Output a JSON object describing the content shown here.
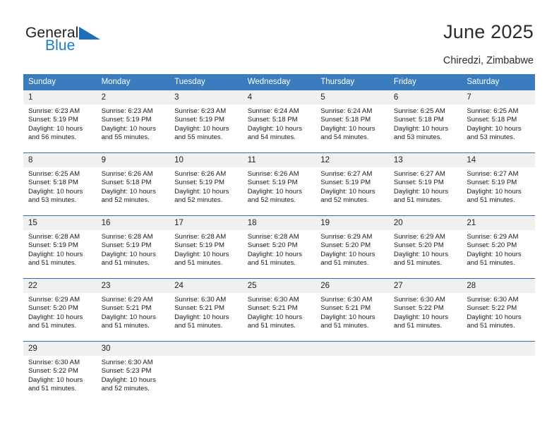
{
  "brand": {
    "name_part1": "General",
    "name_part2": "Blue",
    "triangle_icon": "triangle-icon",
    "color_primary": "#231f20",
    "color_accent": "#1f7ac4"
  },
  "header": {
    "title": "June 2025",
    "subtitle": "Chiredzi, Zimbabwe"
  },
  "calendar": {
    "header_bg": "#3a7cbe",
    "grid_line": "#2f6eaf",
    "daynum_bg": "#f0f0f0",
    "weekdays": [
      "Sunday",
      "Monday",
      "Tuesday",
      "Wednesday",
      "Thursday",
      "Friday",
      "Saturday"
    ],
    "weeks": [
      [
        {
          "day": "1",
          "info": "Sunrise: 6:23 AM\nSunset: 5:19 PM\nDaylight: 10 hours\nand 56 minutes."
        },
        {
          "day": "2",
          "info": "Sunrise: 6:23 AM\nSunset: 5:19 PM\nDaylight: 10 hours\nand 55 minutes."
        },
        {
          "day": "3",
          "info": "Sunrise: 6:23 AM\nSunset: 5:19 PM\nDaylight: 10 hours\nand 55 minutes."
        },
        {
          "day": "4",
          "info": "Sunrise: 6:24 AM\nSunset: 5:18 PM\nDaylight: 10 hours\nand 54 minutes."
        },
        {
          "day": "5",
          "info": "Sunrise: 6:24 AM\nSunset: 5:18 PM\nDaylight: 10 hours\nand 54 minutes."
        },
        {
          "day": "6",
          "info": "Sunrise: 6:25 AM\nSunset: 5:18 PM\nDaylight: 10 hours\nand 53 minutes."
        },
        {
          "day": "7",
          "info": "Sunrise: 6:25 AM\nSunset: 5:18 PM\nDaylight: 10 hours\nand 53 minutes."
        }
      ],
      [
        {
          "day": "8",
          "info": "Sunrise: 6:25 AM\nSunset: 5:18 PM\nDaylight: 10 hours\nand 53 minutes."
        },
        {
          "day": "9",
          "info": "Sunrise: 6:26 AM\nSunset: 5:18 PM\nDaylight: 10 hours\nand 52 minutes."
        },
        {
          "day": "10",
          "info": "Sunrise: 6:26 AM\nSunset: 5:19 PM\nDaylight: 10 hours\nand 52 minutes."
        },
        {
          "day": "11",
          "info": "Sunrise: 6:26 AM\nSunset: 5:19 PM\nDaylight: 10 hours\nand 52 minutes."
        },
        {
          "day": "12",
          "info": "Sunrise: 6:27 AM\nSunset: 5:19 PM\nDaylight: 10 hours\nand 52 minutes."
        },
        {
          "day": "13",
          "info": "Sunrise: 6:27 AM\nSunset: 5:19 PM\nDaylight: 10 hours\nand 51 minutes."
        },
        {
          "day": "14",
          "info": "Sunrise: 6:27 AM\nSunset: 5:19 PM\nDaylight: 10 hours\nand 51 minutes."
        }
      ],
      [
        {
          "day": "15",
          "info": "Sunrise: 6:28 AM\nSunset: 5:19 PM\nDaylight: 10 hours\nand 51 minutes."
        },
        {
          "day": "16",
          "info": "Sunrise: 6:28 AM\nSunset: 5:19 PM\nDaylight: 10 hours\nand 51 minutes."
        },
        {
          "day": "17",
          "info": "Sunrise: 6:28 AM\nSunset: 5:19 PM\nDaylight: 10 hours\nand 51 minutes."
        },
        {
          "day": "18",
          "info": "Sunrise: 6:28 AM\nSunset: 5:20 PM\nDaylight: 10 hours\nand 51 minutes."
        },
        {
          "day": "19",
          "info": "Sunrise: 6:29 AM\nSunset: 5:20 PM\nDaylight: 10 hours\nand 51 minutes."
        },
        {
          "day": "20",
          "info": "Sunrise: 6:29 AM\nSunset: 5:20 PM\nDaylight: 10 hours\nand 51 minutes."
        },
        {
          "day": "21",
          "info": "Sunrise: 6:29 AM\nSunset: 5:20 PM\nDaylight: 10 hours\nand 51 minutes."
        }
      ],
      [
        {
          "day": "22",
          "info": "Sunrise: 6:29 AM\nSunset: 5:20 PM\nDaylight: 10 hours\nand 51 minutes."
        },
        {
          "day": "23",
          "info": "Sunrise: 6:29 AM\nSunset: 5:21 PM\nDaylight: 10 hours\nand 51 minutes."
        },
        {
          "day": "24",
          "info": "Sunrise: 6:30 AM\nSunset: 5:21 PM\nDaylight: 10 hours\nand 51 minutes."
        },
        {
          "day": "25",
          "info": "Sunrise: 6:30 AM\nSunset: 5:21 PM\nDaylight: 10 hours\nand 51 minutes."
        },
        {
          "day": "26",
          "info": "Sunrise: 6:30 AM\nSunset: 5:21 PM\nDaylight: 10 hours\nand 51 minutes."
        },
        {
          "day": "27",
          "info": "Sunrise: 6:30 AM\nSunset: 5:22 PM\nDaylight: 10 hours\nand 51 minutes."
        },
        {
          "day": "28",
          "info": "Sunrise: 6:30 AM\nSunset: 5:22 PM\nDaylight: 10 hours\nand 51 minutes."
        }
      ],
      [
        {
          "day": "29",
          "info": "Sunrise: 6:30 AM\nSunset: 5:22 PM\nDaylight: 10 hours\nand 51 minutes."
        },
        {
          "day": "30",
          "info": "Sunrise: 6:30 AM\nSunset: 5:23 PM\nDaylight: 10 hours\nand 52 minutes."
        },
        {
          "day": "",
          "info": ""
        },
        {
          "day": "",
          "info": ""
        },
        {
          "day": "",
          "info": ""
        },
        {
          "day": "",
          "info": ""
        },
        {
          "day": "",
          "info": ""
        }
      ]
    ]
  }
}
